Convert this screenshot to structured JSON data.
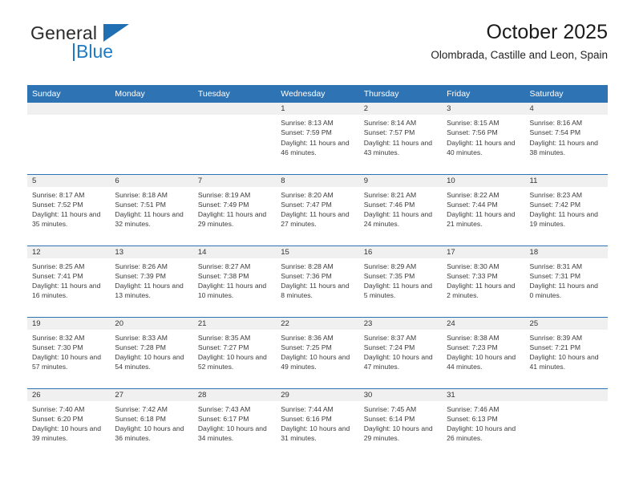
{
  "brand": {
    "name_top": "General",
    "name_bottom": "Blue",
    "accent_color": "#1f7ac4",
    "header_color": "#2e74b5"
  },
  "header": {
    "title": "October 2025",
    "subtitle": "Olombrada, Castille and Leon, Spain"
  },
  "calendar": {
    "weekday_headers": [
      "Sunday",
      "Monday",
      "Tuesday",
      "Wednesday",
      "Thursday",
      "Friday",
      "Saturday"
    ],
    "labels": {
      "sunrise": "Sunrise:",
      "sunset": "Sunset:",
      "daylight": "Daylight:"
    },
    "weeks": [
      [
        {
          "day": "",
          "empty": true
        },
        {
          "day": "",
          "empty": true
        },
        {
          "day": "",
          "empty": true
        },
        {
          "day": "1",
          "sunrise": "Sunrise: 8:13 AM",
          "sunset": "Sunset: 7:59 PM",
          "daylight": "Daylight: 11 hours and 46 minutes."
        },
        {
          "day": "2",
          "sunrise": "Sunrise: 8:14 AM",
          "sunset": "Sunset: 7:57 PM",
          "daylight": "Daylight: 11 hours and 43 minutes."
        },
        {
          "day": "3",
          "sunrise": "Sunrise: 8:15 AM",
          "sunset": "Sunset: 7:56 PM",
          "daylight": "Daylight: 11 hours and 40 minutes."
        },
        {
          "day": "4",
          "sunrise": "Sunrise: 8:16 AM",
          "sunset": "Sunset: 7:54 PM",
          "daylight": "Daylight: 11 hours and 38 minutes."
        }
      ],
      [
        {
          "day": "5",
          "sunrise": "Sunrise: 8:17 AM",
          "sunset": "Sunset: 7:52 PM",
          "daylight": "Daylight: 11 hours and 35 minutes."
        },
        {
          "day": "6",
          "sunrise": "Sunrise: 8:18 AM",
          "sunset": "Sunset: 7:51 PM",
          "daylight": "Daylight: 11 hours and 32 minutes."
        },
        {
          "day": "7",
          "sunrise": "Sunrise: 8:19 AM",
          "sunset": "Sunset: 7:49 PM",
          "daylight": "Daylight: 11 hours and 29 minutes."
        },
        {
          "day": "8",
          "sunrise": "Sunrise: 8:20 AM",
          "sunset": "Sunset: 7:47 PM",
          "daylight": "Daylight: 11 hours and 27 minutes."
        },
        {
          "day": "9",
          "sunrise": "Sunrise: 8:21 AM",
          "sunset": "Sunset: 7:46 PM",
          "daylight": "Daylight: 11 hours and 24 minutes."
        },
        {
          "day": "10",
          "sunrise": "Sunrise: 8:22 AM",
          "sunset": "Sunset: 7:44 PM",
          "daylight": "Daylight: 11 hours and 21 minutes."
        },
        {
          "day": "11",
          "sunrise": "Sunrise: 8:23 AM",
          "sunset": "Sunset: 7:42 PM",
          "daylight": "Daylight: 11 hours and 19 minutes."
        }
      ],
      [
        {
          "day": "12",
          "sunrise": "Sunrise: 8:25 AM",
          "sunset": "Sunset: 7:41 PM",
          "daylight": "Daylight: 11 hours and 16 minutes."
        },
        {
          "day": "13",
          "sunrise": "Sunrise: 8:26 AM",
          "sunset": "Sunset: 7:39 PM",
          "daylight": "Daylight: 11 hours and 13 minutes."
        },
        {
          "day": "14",
          "sunrise": "Sunrise: 8:27 AM",
          "sunset": "Sunset: 7:38 PM",
          "daylight": "Daylight: 11 hours and 10 minutes."
        },
        {
          "day": "15",
          "sunrise": "Sunrise: 8:28 AM",
          "sunset": "Sunset: 7:36 PM",
          "daylight": "Daylight: 11 hours and 8 minutes."
        },
        {
          "day": "16",
          "sunrise": "Sunrise: 8:29 AM",
          "sunset": "Sunset: 7:35 PM",
          "daylight": "Daylight: 11 hours and 5 minutes."
        },
        {
          "day": "17",
          "sunrise": "Sunrise: 8:30 AM",
          "sunset": "Sunset: 7:33 PM",
          "daylight": "Daylight: 11 hours and 2 minutes."
        },
        {
          "day": "18",
          "sunrise": "Sunrise: 8:31 AM",
          "sunset": "Sunset: 7:31 PM",
          "daylight": "Daylight: 11 hours and 0 minutes."
        }
      ],
      [
        {
          "day": "19",
          "sunrise": "Sunrise: 8:32 AM",
          "sunset": "Sunset: 7:30 PM",
          "daylight": "Daylight: 10 hours and 57 minutes."
        },
        {
          "day": "20",
          "sunrise": "Sunrise: 8:33 AM",
          "sunset": "Sunset: 7:28 PM",
          "daylight": "Daylight: 10 hours and 54 minutes."
        },
        {
          "day": "21",
          "sunrise": "Sunrise: 8:35 AM",
          "sunset": "Sunset: 7:27 PM",
          "daylight": "Daylight: 10 hours and 52 minutes."
        },
        {
          "day": "22",
          "sunrise": "Sunrise: 8:36 AM",
          "sunset": "Sunset: 7:25 PM",
          "daylight": "Daylight: 10 hours and 49 minutes."
        },
        {
          "day": "23",
          "sunrise": "Sunrise: 8:37 AM",
          "sunset": "Sunset: 7:24 PM",
          "daylight": "Daylight: 10 hours and 47 minutes."
        },
        {
          "day": "24",
          "sunrise": "Sunrise: 8:38 AM",
          "sunset": "Sunset: 7:23 PM",
          "daylight": "Daylight: 10 hours and 44 minutes."
        },
        {
          "day": "25",
          "sunrise": "Sunrise: 8:39 AM",
          "sunset": "Sunset: 7:21 PM",
          "daylight": "Daylight: 10 hours and 41 minutes."
        }
      ],
      [
        {
          "day": "26",
          "sunrise": "Sunrise: 7:40 AM",
          "sunset": "Sunset: 6:20 PM",
          "daylight": "Daylight: 10 hours and 39 minutes."
        },
        {
          "day": "27",
          "sunrise": "Sunrise: 7:42 AM",
          "sunset": "Sunset: 6:18 PM",
          "daylight": "Daylight: 10 hours and 36 minutes."
        },
        {
          "day": "28",
          "sunrise": "Sunrise: 7:43 AM",
          "sunset": "Sunset: 6:17 PM",
          "daylight": "Daylight: 10 hours and 34 minutes."
        },
        {
          "day": "29",
          "sunrise": "Sunrise: 7:44 AM",
          "sunset": "Sunset: 6:16 PM",
          "daylight": "Daylight: 10 hours and 31 minutes."
        },
        {
          "day": "30",
          "sunrise": "Sunrise: 7:45 AM",
          "sunset": "Sunset: 6:14 PM",
          "daylight": "Daylight: 10 hours and 29 minutes."
        },
        {
          "day": "31",
          "sunrise": "Sunrise: 7:46 AM",
          "sunset": "Sunset: 6:13 PM",
          "daylight": "Daylight: 10 hours and 26 minutes."
        },
        {
          "day": "",
          "empty": true
        }
      ]
    ]
  }
}
